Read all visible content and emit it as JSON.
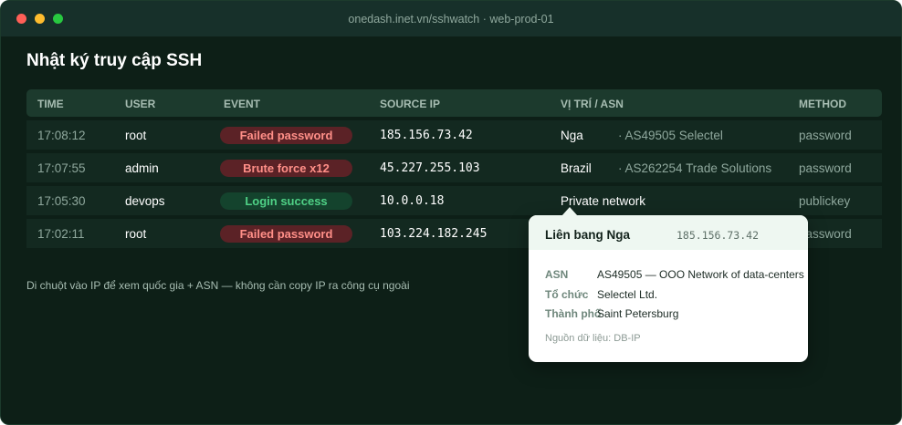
{
  "window": {
    "title": "onedash.inet.vn/sshwatch · web-prod-01"
  },
  "page": {
    "title": "Nhật ký truy cập SSH"
  },
  "table": {
    "headers": {
      "time": "TIME",
      "user": "USER",
      "event": "EVENT",
      "source_ip": "SOURCE IP",
      "location": "VỊ TRÍ / ASN",
      "method": "METHOD"
    },
    "rows": [
      {
        "time": "17:08:12",
        "user": "root",
        "event": "Failed password",
        "event_type": "fail",
        "ip": "185.156.73.42",
        "location": "Nga",
        "asn": "· AS49505 Selectel",
        "method": "password"
      },
      {
        "time": "17:07:55",
        "user": "admin",
        "event": "Brute force x12",
        "event_type": "fail",
        "ip": "45.227.255.103",
        "location": "Brazil",
        "asn": "· AS262254 Trade Solutions",
        "method": "password"
      },
      {
        "time": "17:05:30",
        "user": "devops",
        "event": "Login success",
        "event_type": "success",
        "ip": "10.0.0.18",
        "location": "Private network",
        "asn": "",
        "method": "publickey"
      },
      {
        "time": "17:02:11",
        "user": "root",
        "event": "Failed password",
        "event_type": "fail",
        "ip": "103.224.182.245",
        "location": "",
        "asn": "",
        "method": "password"
      }
    ]
  },
  "hint": "Di chuột vào IP để xem quốc gia + ASN — không cần copy IP ra công cụ ngoài",
  "tooltip": {
    "country": "Liên bang Nga",
    "ip": "185.156.73.42",
    "fields": [
      {
        "label": "ASN",
        "value": "AS49505 — OOO Network of data-centers"
      },
      {
        "label": "Tổ chức",
        "value": "Selectel Ltd."
      },
      {
        "label": "Thành phố",
        "value": "Saint Petersburg"
      }
    ],
    "source": "Nguồn dữ liệu: DB-IP"
  },
  "colors": {
    "background": "#0d1f17",
    "fail_badge": "#5b2226",
    "success_badge": "#14432d"
  }
}
